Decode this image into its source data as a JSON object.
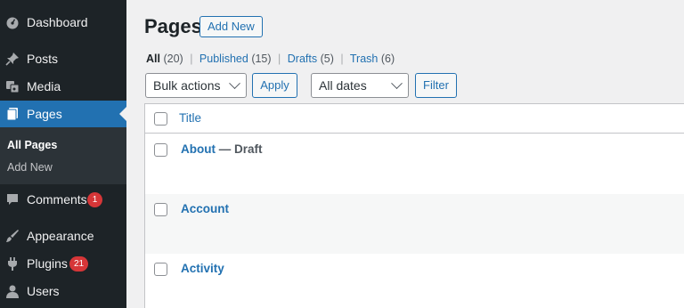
{
  "sidebar": {
    "items": [
      {
        "label": "Dashboard",
        "icon": "dashboard-icon"
      },
      {
        "label": "Posts",
        "icon": "pin-icon"
      },
      {
        "label": "Media",
        "icon": "media-icon"
      },
      {
        "label": "Pages",
        "icon": "pages-icon"
      },
      {
        "label": "Comments",
        "icon": "comment-icon",
        "badge": "1"
      },
      {
        "label": "Appearance",
        "icon": "paintbrush-icon"
      },
      {
        "label": "Plugins",
        "icon": "plugin-icon",
        "badge": "21"
      },
      {
        "label": "Users",
        "icon": "user-icon"
      }
    ],
    "submenu": [
      "All Pages",
      "Add New"
    ]
  },
  "header": {
    "title": "Pages",
    "add_new": "Add New"
  },
  "filters": {
    "all_label": "All",
    "all_count": "(20)",
    "published_label": "Published",
    "published_count": "(15)",
    "drafts_label": "Drafts",
    "drafts_count": "(5)",
    "trash_label": "Trash",
    "trash_count": "(6)",
    "separator": "|"
  },
  "tablenav": {
    "bulk_actions": "Bulk actions",
    "apply": "Apply",
    "all_dates": "All dates",
    "filter": "Filter"
  },
  "table": {
    "column_title": "Title",
    "rows": [
      {
        "title": "About",
        "state": " — Draft"
      },
      {
        "title": "Account",
        "state": ""
      },
      {
        "title": "Activity",
        "state": ""
      }
    ]
  },
  "colors": {
    "sidebar_bg": "#1d2327",
    "accent": "#2271b1",
    "badge": "#d63638"
  }
}
